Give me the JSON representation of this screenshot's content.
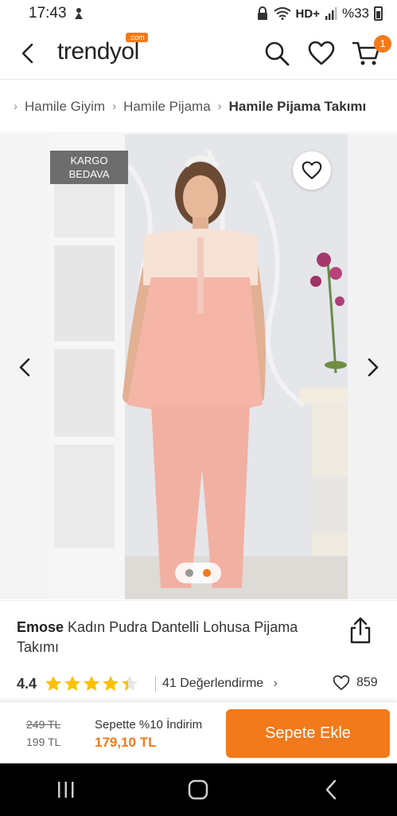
{
  "status_bar": {
    "time": "17:43",
    "network": "HD+",
    "battery": "%33"
  },
  "header": {
    "logo": "trendyol",
    "logo_badge": ".com",
    "cart_count": "1"
  },
  "breadcrumb": {
    "items": [
      "Hamile Giyim",
      "Hamile Pijama",
      "Hamile Pijama Takımı"
    ]
  },
  "gallery": {
    "badge_line1": "KARGO",
    "badge_line2": "BEDAVA",
    "active_slide": 2,
    "slide_count": 2
  },
  "product": {
    "brand": "Emose",
    "name": "Kadın Pudra Dantelli Lohusa Pijama Takımı",
    "rating": "4.4",
    "rating_value": 4.4,
    "review_count": "41",
    "review_label": "Değerlendirme",
    "favorite_count": "859"
  },
  "pricing": {
    "old_price": "249 TL",
    "price": "199 TL",
    "discount_label": "Sepette %10 İndirim",
    "discounted_price": "179,10 TL"
  },
  "actions": {
    "add_to_cart": "Sepete Ekle"
  },
  "colors": {
    "brand_orange": "#f27a1a",
    "star": "#ffc000",
    "pajama": "#f5b6a8"
  }
}
